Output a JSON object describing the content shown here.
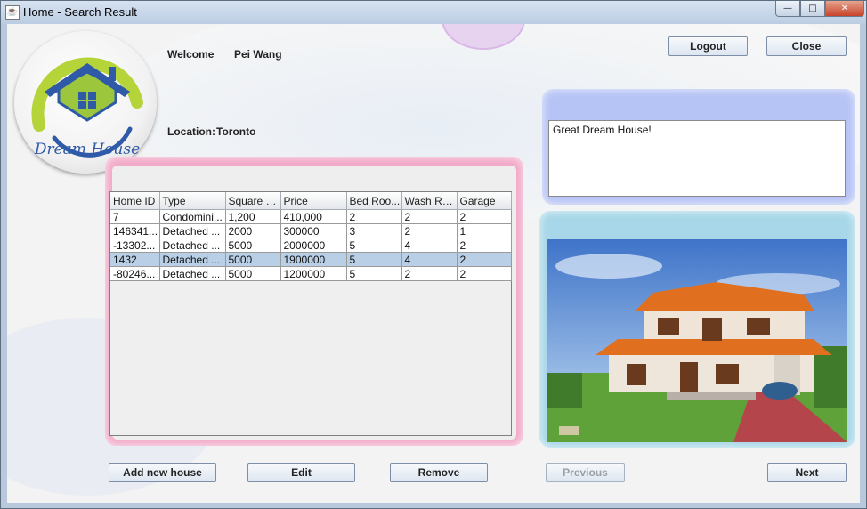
{
  "window": {
    "title": "Home - Search Result",
    "icon": "java-app-icon",
    "controls": [
      "minimize-icon",
      "maximize-icon",
      "close-icon"
    ]
  },
  "logo": {
    "text": "Dream House",
    "colors": {
      "roof": "#2f5aa8",
      "wall": "#9cc63b",
      "ring": "#b5d43a"
    }
  },
  "header": {
    "welcome_label": "Welcome",
    "user_name": "Pei Wang",
    "location_label": "Location:",
    "location_value": "Toronto",
    "logout_label": "Logout",
    "close_label": "Close"
  },
  "table": {
    "columns": [
      "Home ID",
      "Type",
      "Square F...",
      "Price",
      "Bed Roo...",
      "Wash Ro...",
      "Garage"
    ],
    "rows": [
      [
        "7",
        "Condomini...",
        "1,200",
        "410,000",
        "2",
        "2",
        "2"
      ],
      [
        "146341...",
        "Detached ...",
        "2000",
        "300000",
        "3",
        "2",
        "1"
      ],
      [
        "-13302...",
        "Detached ...",
        "5000",
        "2000000",
        "5",
        "4",
        "2"
      ],
      [
        "1432",
        "Detached ...",
        "5000",
        "1900000",
        "5",
        "4",
        "2"
      ],
      [
        "-80246...",
        "Detached ...",
        "5000",
        "1200000",
        "5",
        "2",
        "2"
      ]
    ],
    "selected_row": 3
  },
  "description": {
    "text": "Great Dream House!"
  },
  "photo": {
    "description_icon": "house-photo"
  },
  "actions": {
    "add_label": "Add new house",
    "edit_label": "Edit",
    "remove_label": "Remove",
    "previous_label": "Previous",
    "next_label": "Next"
  },
  "colors": {
    "pink_panel": "#f2a9c7",
    "blue_panel": "#b6c3f5",
    "photo_panel": "#a7d7e8",
    "selection": "#b8cfe5"
  }
}
